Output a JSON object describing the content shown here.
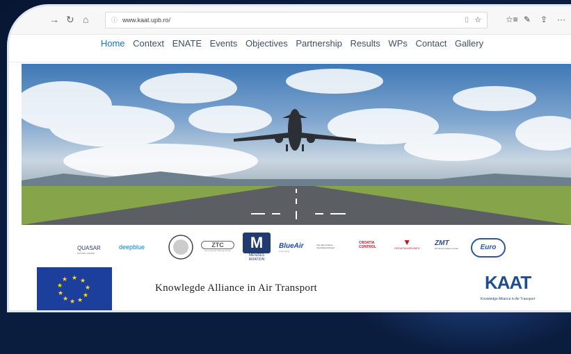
{
  "browser": {
    "url": "www.kaat.upb.ro/",
    "buttons": [
      "back",
      "refresh",
      "home"
    ],
    "toolbar": [
      "reader-view",
      "favorite",
      "favorites-bar",
      "pen",
      "share",
      "more"
    ]
  },
  "site": {
    "nav": [
      "Home",
      "Context",
      "ENATE",
      "Events",
      "Objectives",
      "Partnership",
      "Results",
      "WPs",
      "Contact",
      "Gallery"
    ],
    "active": "Home"
  },
  "logos": [
    {
      "name": "quasar",
      "line1": "QUASAR",
      "line2": "human capital"
    },
    {
      "name": "deepblue",
      "line1": "deepblue"
    },
    {
      "name": "university-seal",
      "line1": ""
    },
    {
      "name": "ztc",
      "line1": "ZTC",
      "line2": "Aeronautical Training Centre"
    },
    {
      "name": "menzies",
      "line1": "M",
      "line2": "MENZIES AVIATION"
    },
    {
      "name": "blueair",
      "line1": "BlueAir",
      "line2": "smart flying"
    },
    {
      "name": "airport",
      "line1": "City Airport Name",
      "line2": "International Airport"
    },
    {
      "name": "croatia-control",
      "line1": "CROATIA",
      "line2": "CONTROL"
    },
    {
      "name": "croatia-airlines",
      "line1": "CROATIA AIRLINES"
    },
    {
      "name": "zmt",
      "line1": "ZMT",
      "line2": "MT Shutu Aviation Centre"
    },
    {
      "name": "eurocontrol",
      "line1": "Euro"
    }
  ],
  "footer": {
    "headline": "Knowlegde Alliance in Air Transport",
    "brand": "KAAT",
    "brand_sub": "Knowledge Alliance in Air Transport"
  },
  "colors": {
    "accent": "#1f6fb3",
    "brand": "#1f4e8f",
    "eu_blue": "#1d3f9c",
    "eu_star": "#ffdd00",
    "background": "#0b1d3f"
  }
}
